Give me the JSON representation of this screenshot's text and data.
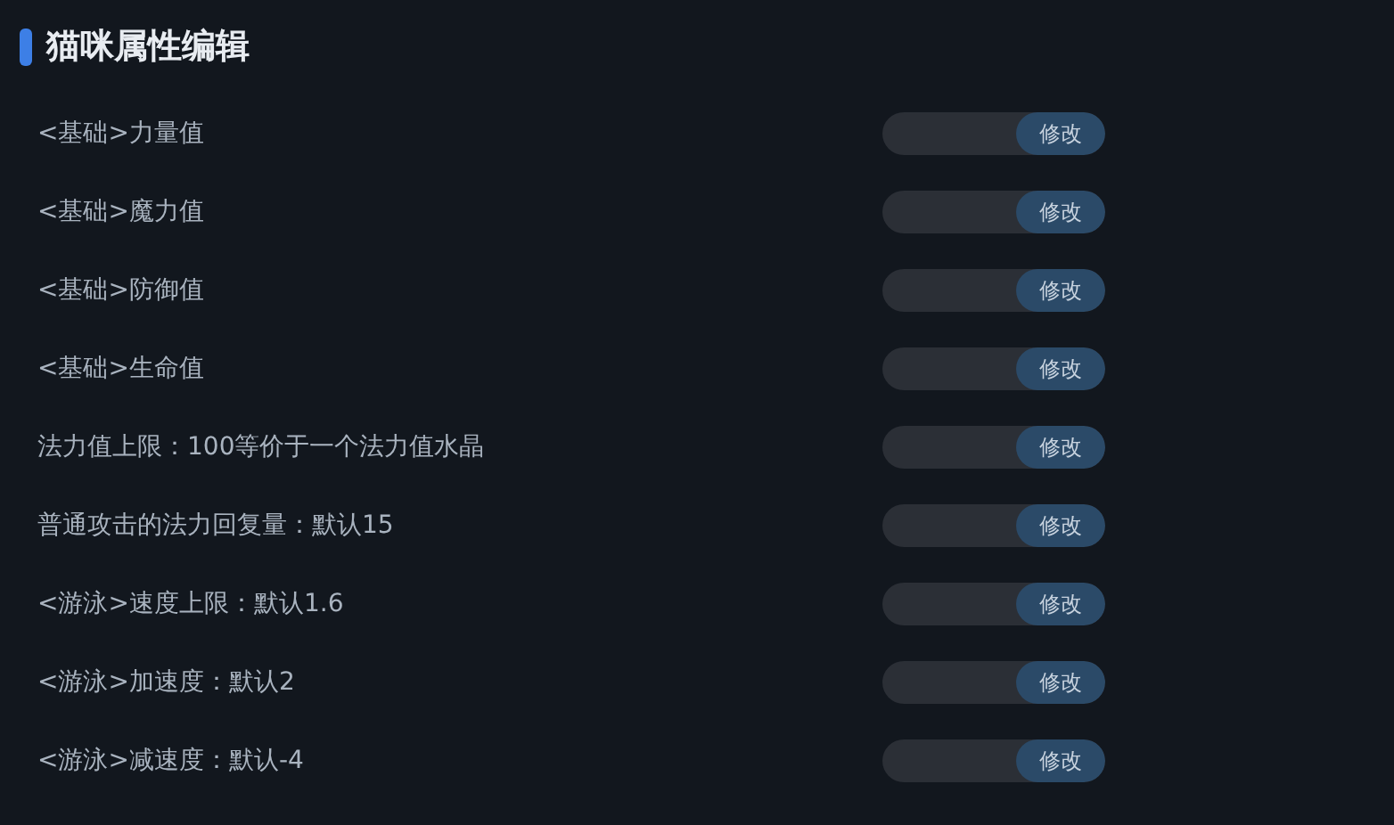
{
  "title": "猫咪属性编辑",
  "rows": [
    {
      "label": "<基础>力量值",
      "button": "修改"
    },
    {
      "label": "<基础>魔力值",
      "button": "修改"
    },
    {
      "label": "<基础>防御值",
      "button": "修改"
    },
    {
      "label": "<基础>生命值",
      "button": "修改"
    },
    {
      "label": "法力值上限：100等价于一个法力值水晶",
      "button": "修改"
    },
    {
      "label": "普通攻击的法力回复量：默认15",
      "button": "修改"
    },
    {
      "label": "<游泳>速度上限：默认1.6",
      "button": "修改"
    },
    {
      "label": "<游泳>加速度：默认2",
      "button": "修改"
    },
    {
      "label": "<游泳>减速度：默认-4",
      "button": "修改"
    }
  ]
}
